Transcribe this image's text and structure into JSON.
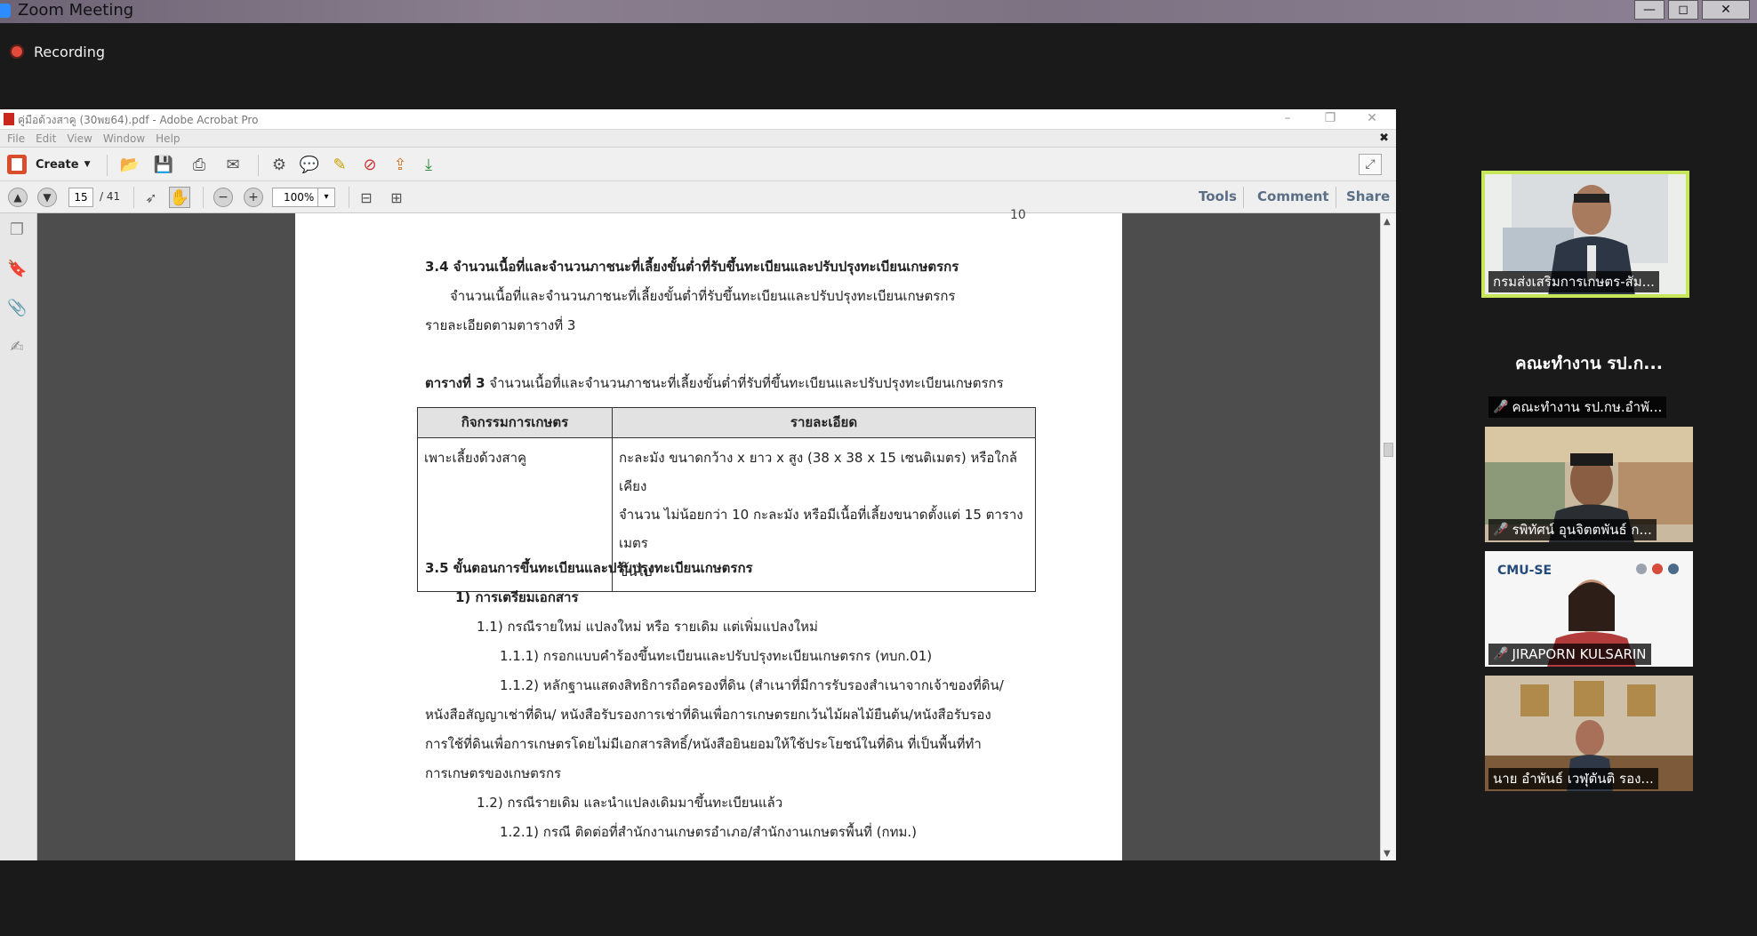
{
  "zoom": {
    "window_title": "Zoom Meeting",
    "recording_label": "Recording",
    "window_buttons": {
      "minimize": "—",
      "maximize": "◻",
      "close": "✕"
    }
  },
  "acrobat": {
    "window_title": "คู่มือด้วงสาคู (30พย64).pdf - Adobe Acrobat Pro",
    "menu": [
      "File",
      "Edit",
      "View",
      "Window",
      "Help"
    ],
    "toolbar": {
      "create_label": "Create",
      "icons": [
        "open-folder-icon",
        "save-icon",
        "print-icon",
        "email-icon",
        "settings-icon",
        "comment-icon",
        "sign-icon",
        "redact-icon",
        "export-icon",
        "combine-icon"
      ]
    },
    "nav": {
      "current_page": "15",
      "total_pages": "/ 41",
      "zoom_level": "100%"
    },
    "tabs": [
      "Tools",
      "Comment",
      "Share"
    ]
  },
  "document": {
    "page_number": "10",
    "heading_3_4": "3.4 จำนวนเนื้อที่และจำนวนภาชนะที่เลี้ยงขั้นต่ำที่รับขึ้นทะเบียนและปรับปรุงทะเบียนเกษตรกร",
    "para_3_4_line1": "จำนวนเนื้อที่และจำนวนภาชนะที่เลี้ยงขั้นต่ำที่รับขึ้นทะเบียนและปรับปรุงทะเบียนเกษตรกร",
    "para_3_4_line2": "รายละเอียดตามตารางที่ 3",
    "table_caption_bold": "ตารางที่ 3",
    "table_caption_rest": " จำนวนเนื้อที่และจำนวนภาชนะที่เลี้ยงขั้นต่ำที่รับที่ขึ้นทะเบียนและปรับปรุงทะเบียนเกษตรกร",
    "table": {
      "headers": [
        "กิจกรรมการเกษตร",
        "รายละเอียด"
      ],
      "row_activity": "เพาะเลี้ยงด้วงสาคู",
      "row_detail_lines": [
        "กะละมัง ขนาดกว้าง x ยาว x สูง (38 x 38 x 15 เซนติเมตร) หรือใกล้เคียง",
        "จำนวน ไม่น้อยกว่า 10 กะละมัง หรือมีเนื้อที่เลี้ยงขนาดตั้งแต่ 15 ตารางเมตร",
        "ขึ้นไป"
      ]
    },
    "heading_3_5": "3.5 ขั้นตอนการขึ้นทะเบียนและปรับปรุงทะเบียนเกษตรกร",
    "step_1": "1) การเตรียมเอกสาร",
    "step_1_1": "1.1) กรณีรายใหม่ แปลงใหม่ หรือ รายเดิม แต่เพิ่มแปลงใหม่",
    "step_1_1_1": "1.1.1) กรอกแบบคำร้องขึ้นทะเบียนและปรับปรุงทะเบียนเกษตรกร (ทบก.01)",
    "step_1_1_2": "1.1.2) หลักฐานแสดงสิทธิการถือครองที่ดิน (สำเนาที่มีการรับรองสำเนาจากเจ้าของที่ดิน/",
    "step_1_1_2_line2": "หนังสือสัญญาเช่าที่ดิน/ หนังสือรับรองการเช่าที่ดินเพื่อการเกษตรยกเว้นไม้ผลไม้ยืนต้น/หนังสือรับรอง",
    "step_1_1_2_line3": "การใช้ที่ดินเพื่อการเกษตรโดยไม่มีเอกสารสิทธิ์/หนังสือยินยอมให้ใช้ประโยชน์ในที่ดิน ที่เป็นพื้นที่ทำ",
    "step_1_1_2_line4": "การเกษตรของเกษตรกร",
    "step_1_2": "1.2) กรณีรายเดิม และนำแปลงเดิมมาขึ้นทะเบียนแล้ว",
    "step_1_2_1": "1.2.1) กรณี ติดต่อที่สำนักงานเกษตรอำเภอ/สำนักงานเกษตรพื้นที่ (กทม.)"
  },
  "participants": [
    {
      "name": "กรมส่งเสริมการเกษตร-สัม...",
      "muted": false,
      "active": true
    },
    {
      "name": "คณะทำงาน รป.กษ.อำพั...",
      "banner": "คณะทำงาน รป.ก...",
      "muted": true
    },
    {
      "name": "รพิทัศน์ อุนจิตตพันธ์ ก...",
      "muted": true
    },
    {
      "name": "JIRAPORN KULSARIN",
      "logo_text": "CMU-SE",
      "muted": true
    },
    {
      "name": "นาย อำพันธ์ เวฬุตันติ รอง...",
      "muted": false
    }
  ],
  "colors": {
    "zoom_bg": "#1a1a1a",
    "active_speaker_border": "#c8e65a",
    "recording_dot": "#e24a3b",
    "acrobat_tab": "#5a6f86"
  }
}
